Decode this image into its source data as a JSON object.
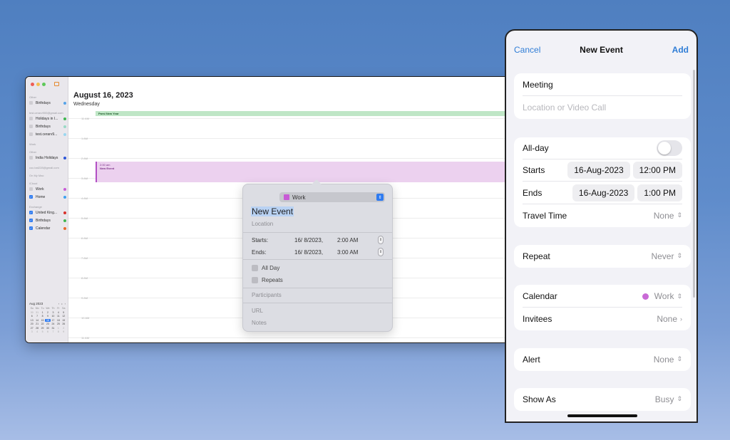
{
  "mac": {
    "sidebar": {
      "groups": [
        {
          "header": "Other",
          "items": [
            {
              "label": "Birthdays",
              "checked": false,
              "color": "#58a3e8"
            }
          ]
        },
        {
          "header": "test.cerarv900@gmail.com",
          "items": [
            {
              "label": "Holidays in I...",
              "checked": false,
              "color": "#3fb650"
            },
            {
              "label": "Birthdays",
              "checked": false,
              "color": "#9ad9c5"
            },
            {
              "label": "test.cerarv9...",
              "checked": false,
              "color": "#9ad7f0"
            }
          ]
        },
        {
          "header": "Work",
          "items": []
        },
        {
          "header": "Other",
          "items": [
            {
              "label": "India Holidays",
              "checked": false,
              "color": "#2d56d8"
            }
          ]
        },
        {
          "header": "coc.bat228@gmail.com",
          "items": []
        },
        {
          "header": "On My Mac",
          "items": []
        },
        {
          "header": "iCloud",
          "items": [
            {
              "label": "Work",
              "checked": false,
              "color": "#c85bd6"
            },
            {
              "label": "Home",
              "checked": true,
              "color": "#3fa2f0"
            }
          ]
        },
        {
          "header": "Exchange",
          "items": [
            {
              "label": "United King...",
              "checked": true,
              "color": "#d8312b"
            },
            {
              "label": "Birthdays",
              "checked": true,
              "color": "#3fb650"
            },
            {
              "label": "Calendar",
              "checked": true,
              "color": "#e8692b"
            }
          ]
        }
      ],
      "mini_calendar": {
        "month": "Aug 2023",
        "weekdays": [
          "Su",
          "Mo",
          "Tu",
          "We",
          "Th",
          "Fr",
          "Sa"
        ],
        "days": [
          "30",
          "31",
          "1",
          "2",
          "3",
          "4",
          "5",
          "6",
          "7",
          "8",
          "9",
          "10",
          "11",
          "12",
          "13",
          "14",
          "15",
          "16",
          "17",
          "18",
          "19",
          "20",
          "21",
          "22",
          "23",
          "24",
          "25",
          "26",
          "27",
          "28",
          "29",
          "30",
          "31",
          "1",
          "2",
          "3",
          "4",
          "5",
          "6",
          "7",
          "8",
          "9"
        ],
        "today": "16"
      }
    },
    "day": {
      "title": "August 16, 2023",
      "weekday": "Wednesday",
      "allday_event": "Parsi New Year",
      "hour_labels": [
        "11 AM",
        "1 AM",
        "2 AM",
        "3 AM",
        "4 AM",
        "5 AM",
        "6 AM",
        "7 AM",
        "8 AM",
        "9 AM",
        "10 AM",
        "11 AM"
      ],
      "event_time": "2:00 am",
      "event_title": "New Event"
    },
    "popover": {
      "calendar": "Work",
      "calendar_color": "#c85bd6",
      "title": "New Event",
      "location_placeholder": "Location",
      "starts_label": "Starts:",
      "starts_date": "16/  8/2023,",
      "starts_time": "2:00 AM",
      "ends_label": "Ends:",
      "ends_date": "16/  8/2023,",
      "ends_time": "3:00 AM",
      "all_day_label": "All Day",
      "repeats_label": "Repeats",
      "participants_label": "Participants",
      "url_label": "URL",
      "notes_label": "Notes"
    }
  },
  "ios": {
    "nav": {
      "cancel": "Cancel",
      "title": "New Event",
      "add": "Add"
    },
    "title_value": "Meeting",
    "location_placeholder": "Location or Video Call",
    "all_day_label": "All-day",
    "starts_label": "Starts",
    "starts_date": "16-Aug-2023",
    "starts_time": "12:00 PM",
    "ends_label": "Ends",
    "ends_date": "16-Aug-2023",
    "ends_time": "1:00 PM",
    "travel_time_label": "Travel Time",
    "travel_time_value": "None",
    "repeat_label": "Repeat",
    "repeat_value": "Never",
    "calendar_label": "Calendar",
    "calendar_value": "Work",
    "calendar_color": "#c96ad6",
    "invitees_label": "Invitees",
    "invitees_value": "None",
    "alert_label": "Alert",
    "alert_value": "None",
    "show_as_label": "Show As",
    "show_as_value": "Busy",
    "accent_color": "#2f7dd6"
  }
}
